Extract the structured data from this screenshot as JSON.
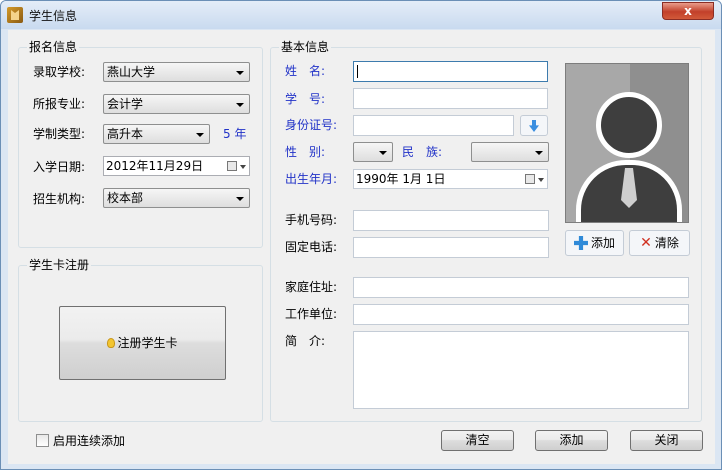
{
  "window": {
    "title": "学生信息",
    "close_label": "x"
  },
  "enroll": {
    "group_title": "报名信息",
    "school_label": "录取学校:",
    "school_value": "燕山大学",
    "major_label": "所报专业:",
    "major_value": "会计学",
    "type_label": "学制类型:",
    "type_value": "高升本",
    "years_text": "5 年",
    "date_label": "入学日期:",
    "date_value": "2012年11月29日",
    "org_label": "招生机构:",
    "org_value": "校本部"
  },
  "card": {
    "group_title": "学生卡注册",
    "register_label": "注册学生卡"
  },
  "basic": {
    "group_title": "基本信息",
    "name_label": "姓　名:",
    "name_value": "",
    "student_no_label": "学　号:",
    "student_no_value": "",
    "id_label": "身份证号:",
    "id_value": "",
    "gender_label": "性　别:",
    "gender_value": "",
    "ethnic_label": "民　族:",
    "ethnic_value": "",
    "birth_label": "出生年月:",
    "birth_value": "1990年 1月 1日",
    "phone_label": "手机号码:",
    "phone_value": "",
    "tel_label": "固定电话:",
    "tel_value": "",
    "address_label": "家庭住址:",
    "address_value": "",
    "work_label": "工作单位:",
    "work_value": "",
    "intro_label": "简　介:",
    "intro_value": "",
    "photo_add_label": "添加",
    "photo_clear_label": "清除"
  },
  "footer": {
    "continuous_label": "启用连续添加",
    "continuous_checked": false,
    "clear_label": "清空",
    "add_label": "添加",
    "close_label": "关闭"
  },
  "colors": {
    "accent_blue": "#2233c8",
    "close_red": "#c2402a"
  },
  "icons": [
    "app-icon",
    "close-icon",
    "calendar-icon",
    "dropdown-arrow-icon",
    "download-arrow-icon",
    "lightbulb-icon",
    "plus-icon",
    "delete-x-icon",
    "avatar-placeholder-icon"
  ]
}
